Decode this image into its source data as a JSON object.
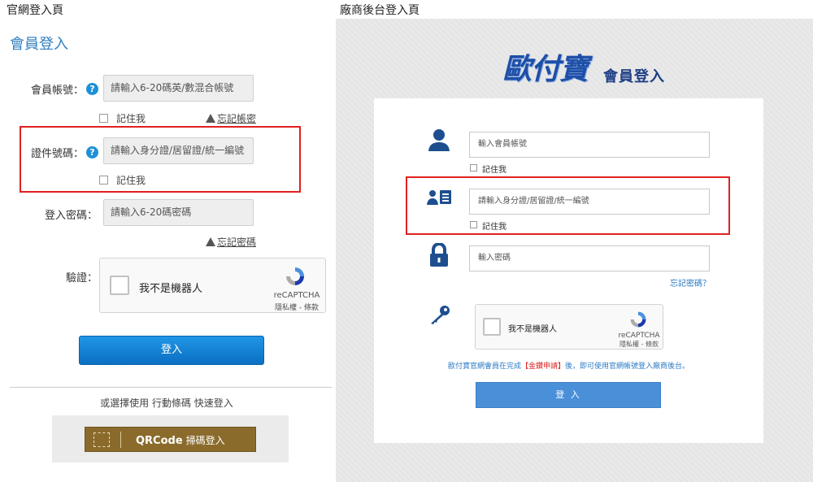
{
  "captions": {
    "left": "官網登入頁",
    "right": "廠商後台登入頁"
  },
  "left": {
    "title": "會員登入",
    "account": {
      "label": "會員帳號：",
      "placeholder": "請輸入6-20碼英/數混合帳號",
      "remember": "記住我",
      "forgot": "忘記帳密"
    },
    "id_number": {
      "label": "證件號碼：",
      "placeholder": "請輸入身分證/居留證/統一編號",
      "remember": "記住我"
    },
    "password": {
      "label": "登入密碼：",
      "placeholder": "請輸入6-20碼密碼",
      "forgot": "忘記密碼"
    },
    "verify": {
      "label": "驗證：",
      "robot_text": "我不是機器人",
      "brand": "reCAPTCHA",
      "terms": "隱私權 - 條款"
    },
    "login_button": "登入",
    "alt_text": "或選擇使用 行動條碼 快速登入",
    "qr_button": {
      "main": "QRCode",
      "sub": "掃碼登入"
    }
  },
  "right": {
    "logo": "歐付寶",
    "logo_sub": "會員登入",
    "account": {
      "placeholder": "輸入會員帳號",
      "remember": "記住我"
    },
    "id_number": {
      "placeholder": "請輸入身分證/居留證/統一編號",
      "remember": "記住我"
    },
    "password": {
      "placeholder": "輸入密碼",
      "forgot": "忘記密碼？"
    },
    "recaptcha": {
      "robot_text": "我不是機器人",
      "brand": "reCAPTCHA",
      "terms": "隱私權 - 條款"
    },
    "notice_pre": "歐付寶官網會員在完成",
    "notice_red": "【金鑽申請】",
    "notice_post": "後，即可使用官網帳號登入廠商後台。",
    "login_button": "登 入"
  },
  "colors": {
    "accent_blue": "#2f7fc1",
    "highlight_red": "#e02020",
    "qr_gold": "#8a6b2b",
    "right_button": "#4a90d9"
  }
}
